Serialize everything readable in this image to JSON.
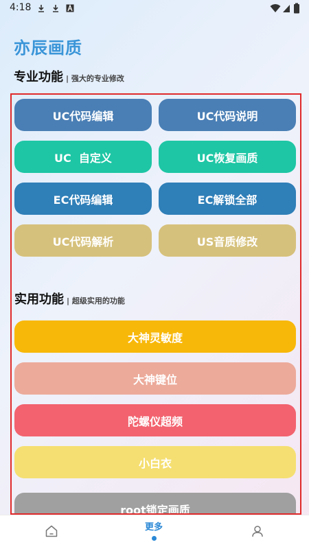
{
  "status_bar": {
    "time": "4:18",
    "left_icons": [
      "download-icon",
      "download-icon",
      "font-a-icon"
    ],
    "right_icons": [
      "wifi-icon",
      "cellular-signal-icon",
      "battery-icon"
    ]
  },
  "app_title": "亦辰画质",
  "pro_section": {
    "title": "专业功能",
    "subtitle": "| 强大的专业修改",
    "buttons": [
      {
        "label": "UC代码编辑",
        "color": "#4a7fb5"
      },
      {
        "label": "UC代码说明",
        "color": "#4a7fb5"
      },
      {
        "label": "UC  自定义",
        "color": "#1ec6a5"
      },
      {
        "label": "UC恢复画质",
        "color": "#1ec6a5"
      },
      {
        "label": "EC代码编辑",
        "color": "#2f7fb8"
      },
      {
        "label": "EC解锁全部",
        "color": "#2f7fb8"
      },
      {
        "label": "UC代码解析",
        "color": "#d6c17c"
      },
      {
        "label": "US音质修改",
        "color": "#d6c17c"
      }
    ]
  },
  "util_section": {
    "title": "实用功能",
    "subtitle": "| 超级实用的功能",
    "buttons": [
      {
        "label": "大神灵敏度",
        "color": "#f8b80a"
      },
      {
        "label": "大神键位",
        "color": "#ecaa9a"
      },
      {
        "label": "陀螺仪超频",
        "color": "#f2636f"
      },
      {
        "label": "小白衣",
        "color": "#f5df72"
      },
      {
        "label": "root锁定画质",
        "color": "#a0a0a0"
      }
    ]
  },
  "bottom_nav": {
    "items": [
      {
        "name": "home",
        "icon": "home-icon",
        "label": ""
      },
      {
        "name": "more",
        "icon": "",
        "label": "更多",
        "active": true
      },
      {
        "name": "profile",
        "icon": "user-icon",
        "label": ""
      }
    ],
    "accent": "#2a88d6"
  },
  "frame_color": "#e02a2a"
}
